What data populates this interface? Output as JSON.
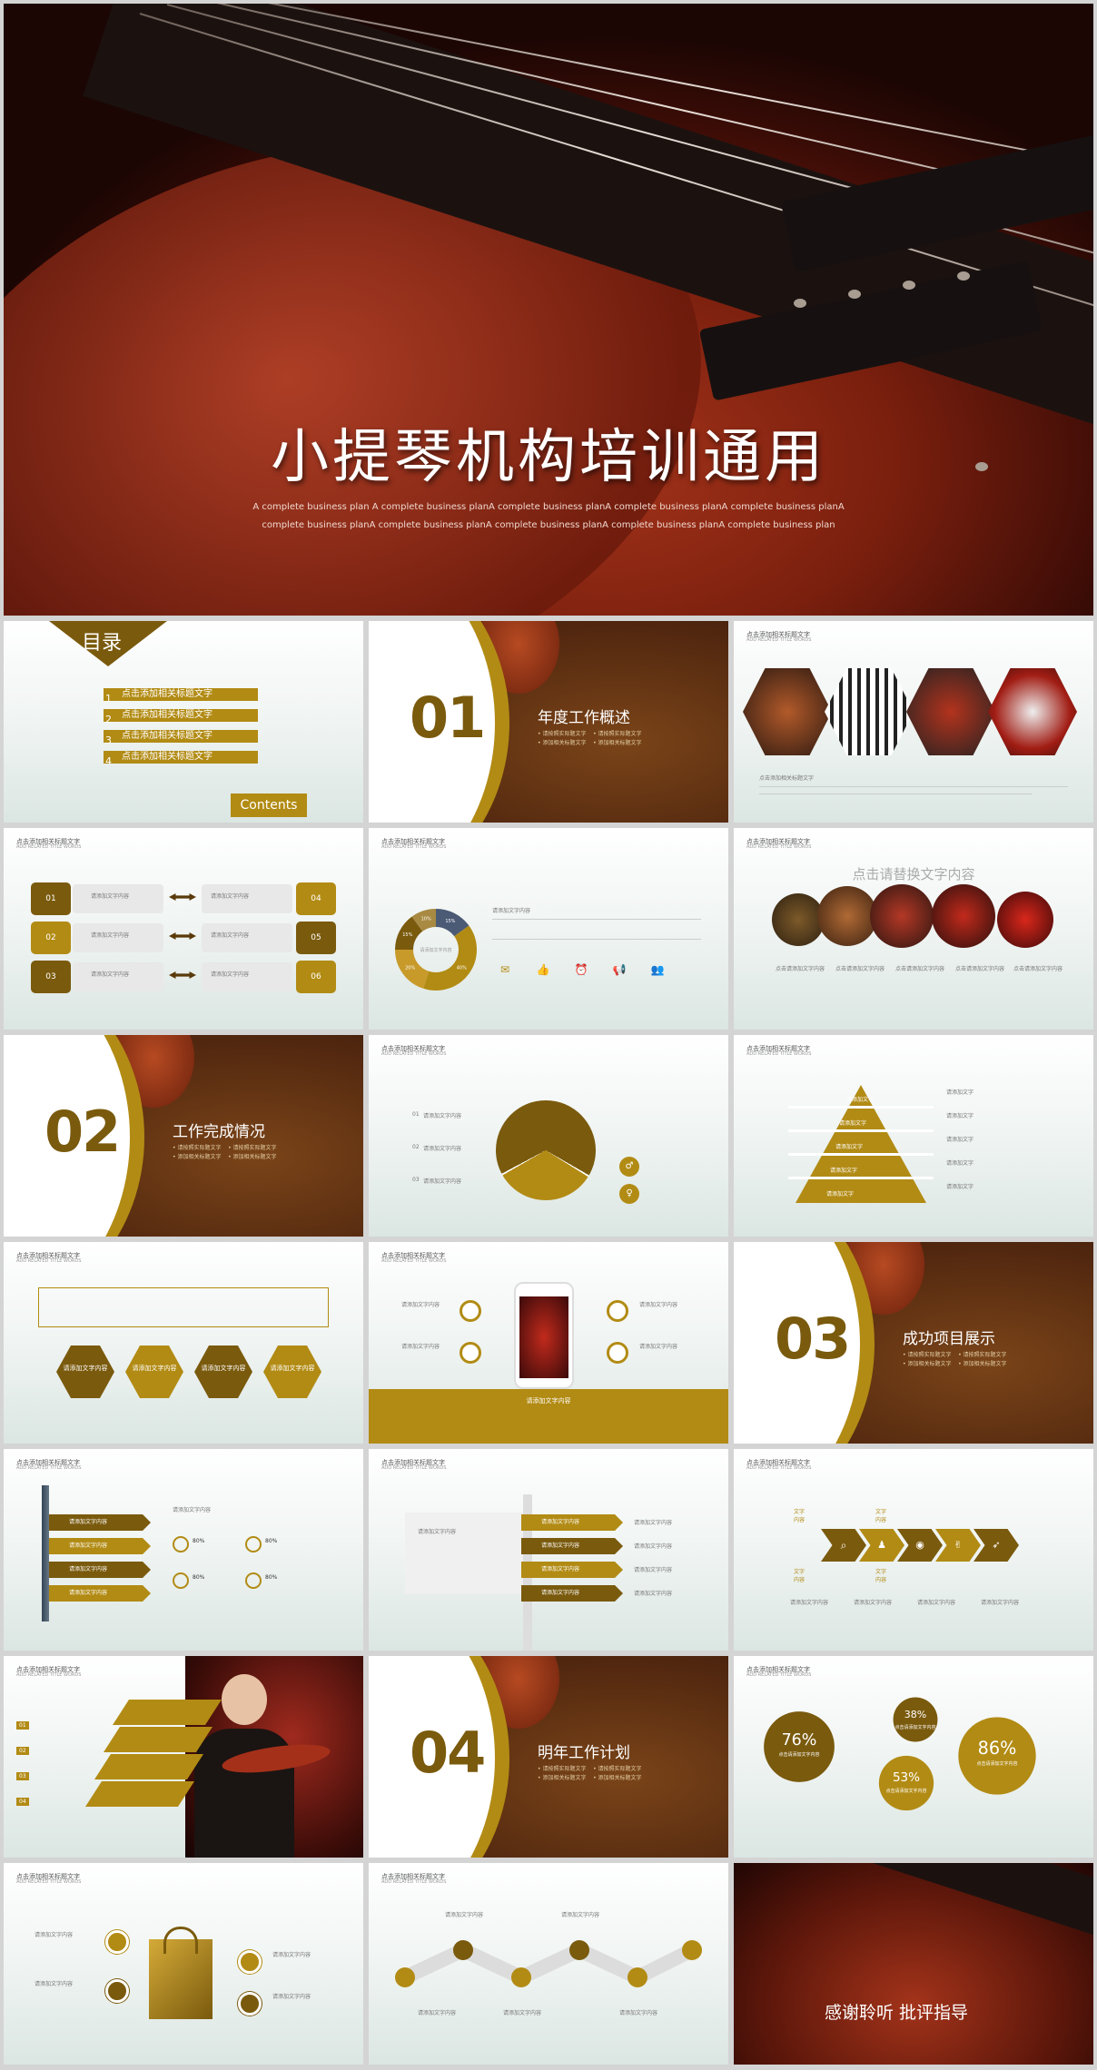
{
  "cover": {
    "title": "小提琴机构培训通用",
    "subtitle": "A complete  business plan A  complete  business planA complete  business planA complete  business planA complete  business planA complete  business planA complete  business planA complete  business planA complete  business planA complete  business plan"
  },
  "toc": {
    "title": "目录",
    "items": [
      "点击添加相关标题文字",
      "点击添加相关标题文字",
      "点击添加相关标题文字",
      "点击添加相关标题文字"
    ],
    "nums": [
      "1",
      "2",
      "3",
      "4"
    ],
    "contents_label": "Contents"
  },
  "sections": [
    {
      "num": "01",
      "title": "年度工作概述",
      "sub": "• 请按照实际题文字    • 请按照实际题文字\n• 添加相关标题文字    • 添加相关标题文字"
    },
    {
      "num": "02",
      "title": "工作完成情况",
      "sub": "• 请按照实际题文字    • 请按照实际题文字\n• 添加相关标题文字    • 添加相关标题文字"
    },
    {
      "num": "03",
      "title": "成功项目展示",
      "sub": "• 请按照实际题文字    • 请按照实际题文字\n• 添加相关标题文字    • 添加相关标题文字"
    },
    {
      "num": "04",
      "title": "明年工作计划",
      "sub": "• 请按照实际题文字    • 请按照实际题文字\n• 添加相关标题文字    • 添加相关标题文字"
    }
  ],
  "slide_header": {
    "line1": "点击添加相关标题文字",
    "line2": "ADD RELATED TITLE WORDS"
  },
  "slide3": {
    "caption": "点击添加相关标题文字"
  },
  "slide4": {
    "left": [
      "01",
      "02",
      "03"
    ],
    "right": [
      "04",
      "05",
      "06"
    ],
    "label": "请添加文字内容"
  },
  "slide5": {
    "label": "请添加文字内容",
    "chart_data": {
      "type": "pie",
      "values": [
        15,
        40,
        20,
        15,
        10
      ],
      "labels": [
        "15%",
        "40%",
        "20%",
        "15%",
        "10%"
      ]
    }
  },
  "slide6": {
    "title": "点击请替换文字内容",
    "label": "点击请添加文字内容"
  },
  "slide8": {
    "items": [
      "01",
      "02",
      "03"
    ],
    "label": "请添加文字内容"
  },
  "slide9": {
    "label": "请添加文字"
  },
  "slide10": {
    "hex": [
      "请添加文字内容",
      "请添加文字内容",
      "请添加文字内容",
      "请添加文字内容"
    ]
  },
  "slide11": {
    "label": "请添加文字内容",
    "banner": "请添加文字内容"
  },
  "slide13": {
    "bars": [
      "请添加文字内容",
      "请添加文字内容",
      "请添加文字内容",
      "请添加文字内容"
    ],
    "pct": [
      "80%",
      "80%",
      "80%",
      "80%"
    ]
  },
  "slide14": {
    "bars": [
      "请添加文字内容",
      "请添加文字内容",
      "请添加文字内容",
      "请添加文字内容"
    ]
  },
  "slide15": {
    "label": "请添加文字内容",
    "tag": "文字\n内容"
  },
  "slide16": {
    "nums": [
      "01",
      "02",
      "03",
      "04"
    ]
  },
  "slide18": {
    "chart_data": {
      "type": "bubble",
      "values": [
        76,
        38,
        53,
        86
      ],
      "labels": [
        "76%",
        "38%",
        "53%",
        "86%"
      ]
    },
    "label": "点击请添加文字内容"
  },
  "slide20": {
    "label": "请添加文字内容"
  },
  "ending": {
    "title": "感谢聆听  批评指导"
  }
}
